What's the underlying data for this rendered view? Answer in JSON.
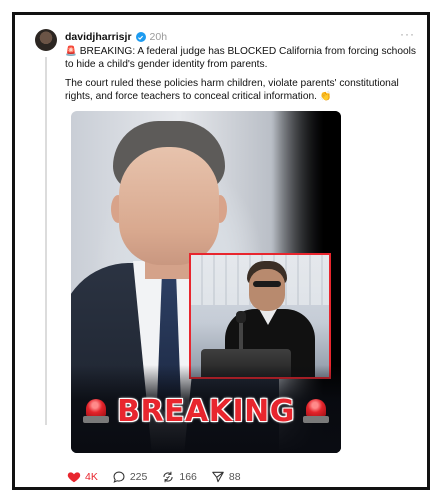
{
  "post": {
    "username": "davidjharrisjr",
    "time": "20h",
    "more_label": "···",
    "line1_emoji": "🚨",
    "line1_text": "BREAKING: A federal judge has BLOCKED California from forcing schools to hide a child's gender identity from parents.",
    "line2_text": "The court ruled these policies harm children, violate parents' constitutional rights, and force teachers to conceal critical information.",
    "line2_emoji": "👏"
  },
  "media": {
    "banner_text": "BREAKING",
    "accent_color": "#e8262e"
  },
  "actions": {
    "likes": "4K",
    "comments": "225",
    "reposts": "166",
    "shares": "88"
  },
  "icons": {
    "verified": "verified-badge-icon",
    "like": "heart-icon",
    "comment": "comment-bubble-icon",
    "repost": "repost-icon",
    "share": "send-icon"
  }
}
